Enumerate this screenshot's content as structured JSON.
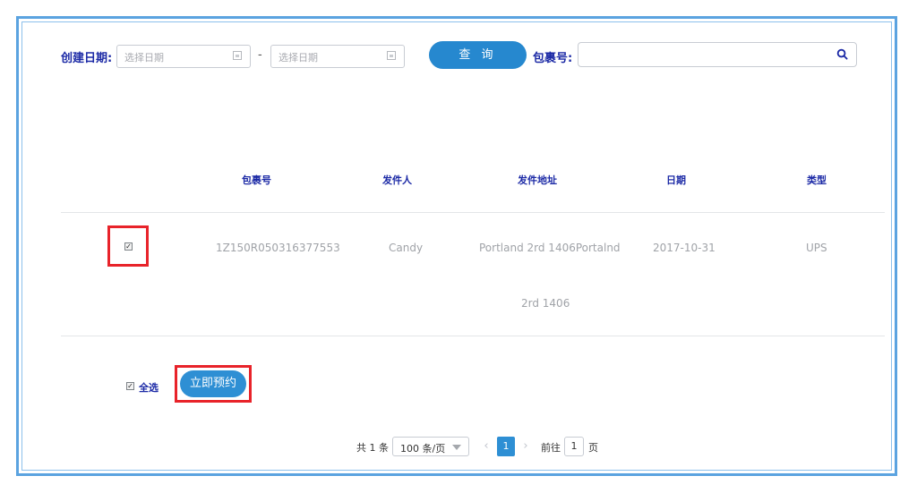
{
  "filters": {
    "created_date_label": "创建日期:",
    "start_date_placeholder": "选择日期",
    "range_separator": "-",
    "end_date_placeholder": "选择日期",
    "query_button": "查 询",
    "package_no_label": "包裹号:",
    "package_no_value": ""
  },
  "table": {
    "headers": [
      "包裹号",
      "发件人",
      "发件地址",
      "日期",
      "类型"
    ],
    "rows": [
      {
        "checked": true,
        "package_no": "1Z150R050316377553",
        "sender": "Candy",
        "address_line1": "Portland 2rd 1406Portalnd",
        "address_line2": "2rd 1406",
        "date": "2017-10-31",
        "type": "UPS"
      }
    ]
  },
  "footer": {
    "select_all_label": "全选",
    "select_all_checked": true,
    "book_button": "立即预约"
  },
  "pagination": {
    "total_text": "共 1 条",
    "page_size": "100 条/页",
    "current_page": "1",
    "goto_label": "前往",
    "goto_value": "1",
    "page_unit": "页"
  },
  "colors": {
    "frame": "#5ba3e0",
    "accent": "#2688cf",
    "label": "#1c2aa6",
    "highlight": "#e8232a"
  },
  "icons": {
    "calendar": "calendar-icon",
    "search": "search-icon",
    "prev": "chevron-left-icon",
    "next": "chevron-right-icon",
    "dropdown": "caret-down-icon"
  }
}
